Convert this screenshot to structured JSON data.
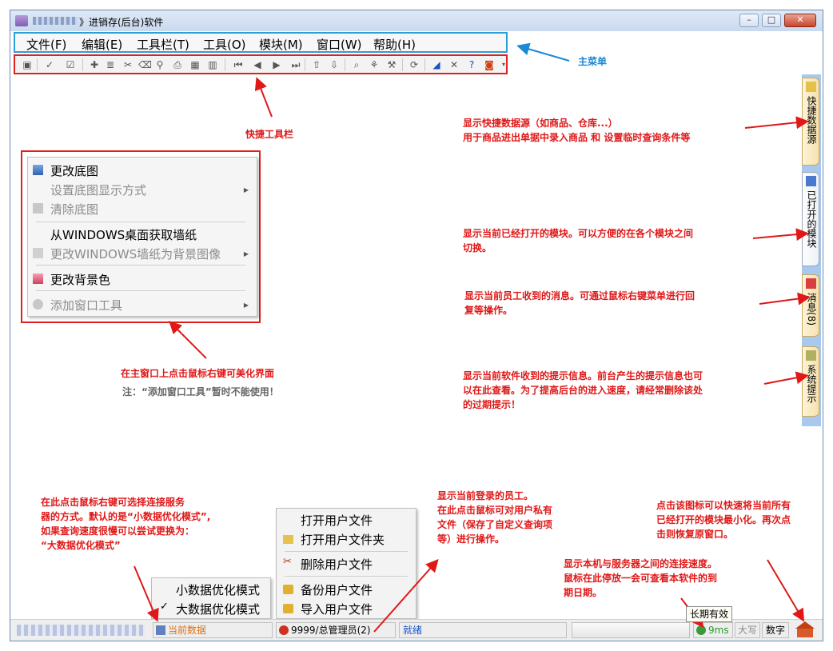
{
  "window": {
    "title": "》进销存(后台)软件",
    "btn_minimize": "–",
    "btn_maximize": "□",
    "btn_close": "✕"
  },
  "menu": {
    "file": "文件(F)",
    "edit": "编辑(E)",
    "toolbar": "工具栏(T)",
    "tools": "工具(O)",
    "module": "模块(M)",
    "window": "窗口(W)",
    "help": "帮助(H)"
  },
  "sidebar": {
    "tabs": [
      "快捷数据源",
      "已打开的模块",
      "消息(8)",
      "系统提示"
    ]
  },
  "context_menu": {
    "change_bg": "更改底图",
    "bg_display_mode": "设置底图显示方式",
    "clear_bg": "清除底图",
    "get_wallpaper": "从WINDOWS桌面获取墙纸",
    "set_wallpaper": "更改WINDOWS墙纸为背景图像",
    "change_bg_color": "更改背景色",
    "add_window_tool": "添加窗口工具"
  },
  "annotations": {
    "main_menu": "主菜单",
    "quick_toolbar": "快捷工具栏",
    "quick_source": [
      "显示快捷数据源（如商品、仓库...）",
      "用于商品进出单据中录入商品 和 设置临时查询条件等"
    ],
    "opened_modules": [
      "显示当前已经打开的模块。可以方便的在各个模块之间",
      "切换。"
    ],
    "messages": [
      "显示当前员工收到的消息。可通过鼠标右键菜单进行回",
      "复等操作。"
    ],
    "system_tips": [
      "显示当前软件收到的提示信息。前台产生的提示信息也可",
      "以在此查看。为了提高后台的进入速度，请经常删除该处",
      "的过期提示！"
    ],
    "right_click_main": "在主窗口上点击鼠标右键可美化界面",
    "note_add_tool": "注：“添加窗口工具”暂时不能使用！",
    "data_mode": [
      "在此点击鼠标右键可选择连接服务",
      "器的方式。默认的是“小数据优化模式”,",
      "如果查询速度很慢可以尝试更换为：",
      "“大数据优化模式”"
    ],
    "current_user": [
      "显示当前登录的员工。",
      "在此点击鼠标可对用户私有",
      "文件（保存了自定义查询项",
      "等）进行操作。"
    ],
    "minimize_all": [
      "点击该图标可以快速将当前所有",
      "已经打开的模块最小化。再次点",
      "击则恢复原窗口。"
    ],
    "speed": [
      "显示本机与服务器之间的连接速度。",
      "鼠标在此停放一会可查看本软件的到",
      "期日期。"
    ]
  },
  "data_mode_menu": {
    "small": "小数据优化模式",
    "large": "大数据优化模式",
    "check": "✓"
  },
  "user_file_menu": {
    "open_file": "打开用户文件",
    "open_folder": "打开用户文件夹",
    "delete_file": "删除用户文件",
    "backup_file": "备份用户文件",
    "import_file": "导入用户文件"
  },
  "statusbar": {
    "data_mode": "当前数据",
    "user": "9999/总管理员(2)",
    "state": "就绪",
    "speed": "9ms",
    "caps": "大写",
    "num": "数字",
    "tooltip": "长期有效"
  }
}
